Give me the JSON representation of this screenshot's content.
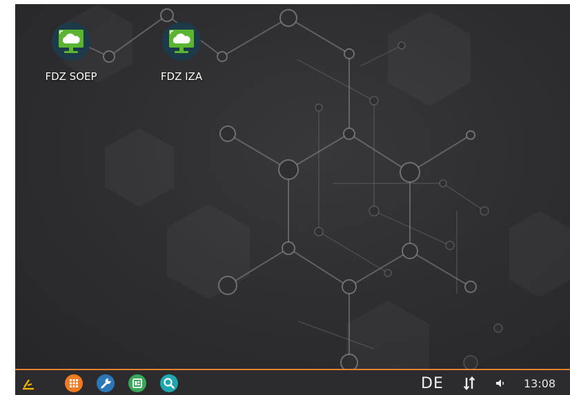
{
  "desktop": {
    "icons": [
      {
        "label": "FDZ SOEP",
        "icon": "remote-desktop-cloud-icon"
      },
      {
        "label": "FDZ IZA",
        "icon": "remote-desktop-cloud-icon"
      }
    ]
  },
  "taskbar": {
    "start_icon": "start-menu-icon",
    "launchers": [
      {
        "icon": "app-grid-icon",
        "color": "#f07b22"
      },
      {
        "icon": "wrench-icon",
        "color": "#2b78b8"
      },
      {
        "icon": "window-manager-icon",
        "color": "#3aa85a"
      },
      {
        "icon": "search-icon",
        "color": "#1fa7b0"
      }
    ],
    "language": "DE",
    "network_icon": "network-updown-icon",
    "volume_icon": "speaker-icon",
    "clock": "13:08"
  },
  "colors": {
    "accent": "#e8822e",
    "taskbar": "#2c2c2e",
    "icon_green": "#5cb531"
  }
}
